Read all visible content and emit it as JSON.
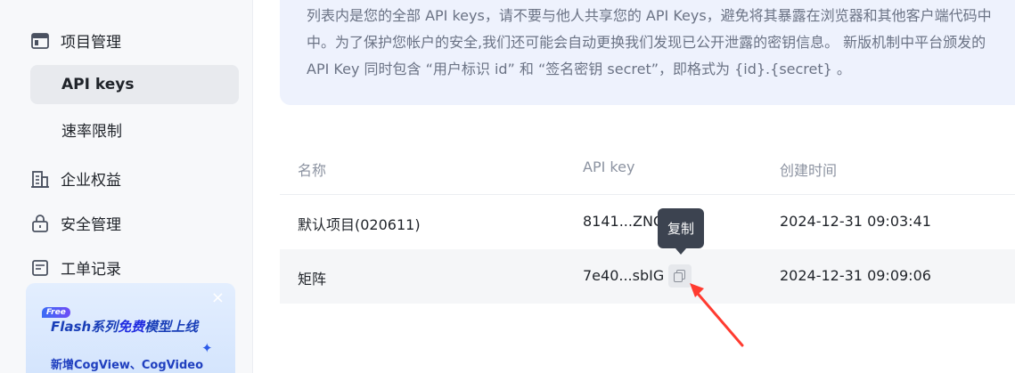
{
  "sidebar": {
    "project_mgmt": "项目管理",
    "api_keys": "API keys",
    "rate_limit": "速率限制",
    "enterprise": "企业权益",
    "security": "安全管理",
    "tickets": "工单记录"
  },
  "promo": {
    "badge": "Free",
    "title_prefix": "Flash系列",
    "title_highlight": "免费",
    "title_suffix": "模型上线",
    "subtitle": "新增CogView、CogVideo",
    "close": "×"
  },
  "notice": {
    "line1": "列表内是您的全部 API keys，请不要与他人共享您的 API Keys，避免将其暴露在浏览器和其他客户端代码中",
    "line2": "中。为了保护您帐户的安全,我们还可能会自动更换我们发现已公开泄露的密钥信息。 新版机制中平台颁发的",
    "line3": "API Key 同时包含 “用户标识 id” 和 “签名密钥 secret”，即格式为 {id}.{secret} 。"
  },
  "table": {
    "headers": {
      "name": "名称",
      "key": "API key",
      "created": "创建时间"
    },
    "rows": [
      {
        "name": "默认项目(020611)",
        "key": "8141...ZNCl",
        "created": "2024-12-31 09:03:41"
      },
      {
        "name": "矩阵",
        "key": "7e40...sbIG",
        "created": "2024-12-31 09:09:06"
      }
    ]
  },
  "tooltip": {
    "label": "复制"
  },
  "colors": {
    "accent": "#3b6cf5",
    "annotation_arrow": "#ff3b30"
  }
}
